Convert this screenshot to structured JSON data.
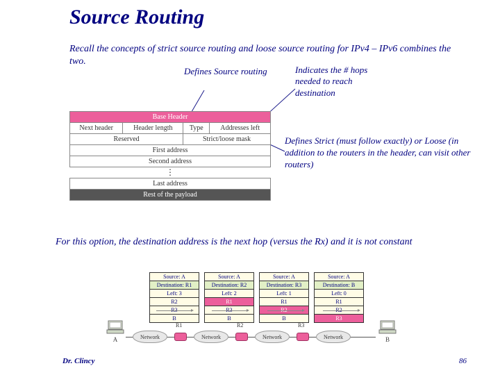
{
  "title": "Source Routing",
  "intro": "Recall the concepts of strict source routing and loose source routing for IPv4 – IPv6 combines the two.",
  "annotations": {
    "defines_source": "Defines Source routing",
    "indicates_hops": "Indicates the # hops needed to reach destination",
    "strict_loose": "Defines Strict (must follow exactly) or Loose (in addition to the routers in the header, can visit other routers)"
  },
  "header_table": {
    "top_bar": "Base Header",
    "row1": [
      "Next header",
      "Header length",
      "Type",
      "Addresses left"
    ],
    "row2": [
      "Reserved",
      "Strict/loose mask"
    ],
    "row3": "First address",
    "row4": "Second address",
    "row5": "Last address",
    "footer": "Rest of the payload"
  },
  "paragraph2": "For this option, the destination address is the next hop (versus the Rx) and it is not constant",
  "routing": {
    "panels": [
      {
        "sa": "Source: A",
        "da": "Destination: R1",
        "lf": "Left: 3",
        "rows": [
          "R2",
          "R3",
          "B"
        ],
        "pink_idx": -1
      },
      {
        "sa": "Source: A",
        "da": "Destination: R2",
        "lf": "Left: 2",
        "rows": [
          "R1",
          "R3",
          "B"
        ],
        "pink_idx": 0
      },
      {
        "sa": "Source: A",
        "da": "Destination: R3",
        "lf": "Left: 1",
        "rows": [
          "R1",
          "R2",
          "B"
        ],
        "pink_idx": 1
      },
      {
        "sa": "Source: A",
        "da": "Destination: B",
        "lf": "Left: 0",
        "rows": [
          "R1",
          "R2",
          "R3"
        ],
        "pink_idx": 2
      }
    ],
    "hostA": "A",
    "hostB": "B",
    "routers": [
      "R1",
      "R2",
      "R3"
    ],
    "cloud": "Network"
  },
  "footer": {
    "author": "Dr. Clincy",
    "page": "86"
  }
}
